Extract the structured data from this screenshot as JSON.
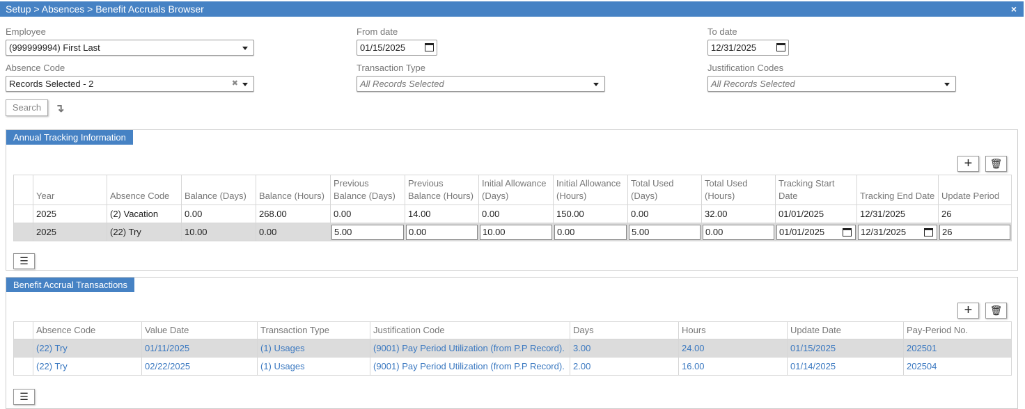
{
  "title": "Setup > Absences > Benefit Accruals Browser",
  "close_icon": "×",
  "filters": {
    "employee": {
      "label": "Employee",
      "value": "(999999994) First Last"
    },
    "from_date": {
      "label": "From date",
      "value": "01/15/2025"
    },
    "to_date": {
      "label": "To date",
      "value": "12/31/2025"
    },
    "absence_code": {
      "label": "Absence Code",
      "value": "Records Selected - 2"
    },
    "transaction_type": {
      "label": "Transaction Type",
      "placeholder": "All Records Selected"
    },
    "justification_codes": {
      "label": "Justification Codes",
      "placeholder": "All Records Selected"
    },
    "search_label": "Search"
  },
  "annual": {
    "title": "Annual Tracking Information",
    "headers": [
      "Year",
      "Absence Code",
      "Balance (Days)",
      "Balance (Hours)",
      "Previous Balance (Days)",
      "Previous Balance (Hours)",
      "Initial Allowance (Days)",
      "Initial Allowance (Hours)",
      "Total Used (Days)",
      "Total Used (Hours)",
      "Tracking Start Date",
      "Tracking End Date",
      "Update Period"
    ],
    "rows": [
      [
        "2025",
        "(2) Vacation",
        "0.00",
        "268.00",
        "0.00",
        "14.00",
        "0.00",
        "150.00",
        "0.00",
        "32.00",
        "01/01/2025",
        "12/31/2025",
        "26"
      ],
      [
        "2025",
        "(22) Try",
        "10.00",
        "0.00",
        "5.00",
        "0.00",
        "10.00",
        "0.00",
        "5.00",
        "0.00",
        "01/01/2025",
        "12/31/2025",
        "26"
      ]
    ]
  },
  "transactions": {
    "title": "Benefit Accrual Transactions",
    "headers": [
      "Absence Code",
      "Value Date",
      "Transaction Type",
      "Justification Code",
      "Days",
      "Hours",
      "Update Date",
      "Pay-Period No."
    ],
    "rows": [
      [
        "(22) Try",
        "01/11/2025",
        "(1) Usages",
        "(9001) Pay Period Utilization (from P.P Record).",
        "3.00",
        "24.00",
        "01/15/2025",
        "202501"
      ],
      [
        "(22) Try",
        "02/22/2025",
        "(1) Usages",
        "(9001) Pay Period Utilization (from P.P Record).",
        "2.00",
        "16.00",
        "01/14/2025",
        "202504"
      ]
    ]
  }
}
